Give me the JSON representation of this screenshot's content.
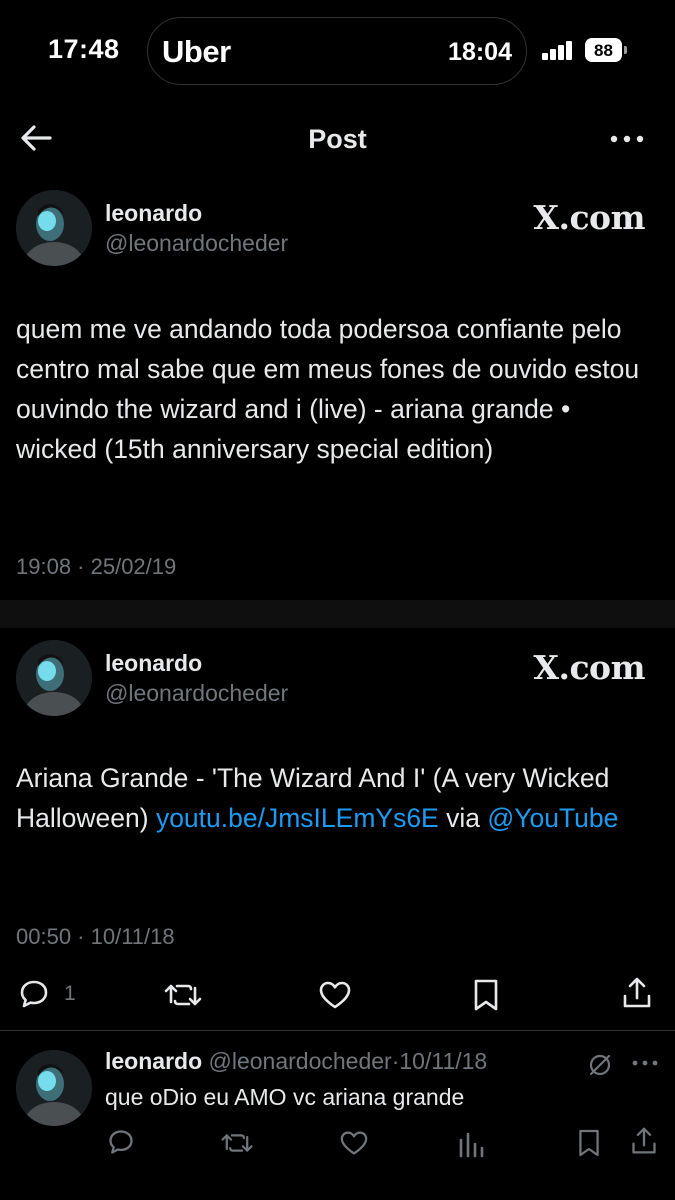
{
  "status_bar": {
    "time": "17:48",
    "live_activity_app": "Uber",
    "live_activity_time": "18:04",
    "battery": "88"
  },
  "header": {
    "title": "Post",
    "back_icon": "arrow-left-icon",
    "more_icon": "more-horizontal-icon"
  },
  "posts": [
    {
      "display_name": "leonardo",
      "handle": "@leonardocheder",
      "source": "X.com",
      "text": "quem me ve andando toda podersoa confiante pelo centro mal sabe que em meus fones de ouvido estou ouvindo the wizard and i (live) - ariana grande • wicked (15th anniversary special edition)",
      "timestamp": "19:08 · 25/02/19"
    },
    {
      "display_name": "leonardo",
      "handle": "@leonardocheder",
      "source": "X.com",
      "text_before_link": "Ariana Grande - 'The Wizard And I' (A very Wicked Halloween) ",
      "link": "youtu.be/JmsILEmYs6E",
      "text_after_link": " via ",
      "mention": "@YouTube",
      "timestamp": "00:50 · 10/11/18",
      "actions": {
        "reply_count": "1"
      }
    }
  ],
  "reply": {
    "display_name": "leonardo",
    "handle": "@leonardocheder",
    "date": "10/11/18",
    "text": "que oDio eu AMO vc ariana grande"
  },
  "colors": {
    "background": "#000000",
    "text": "#e7e9ea",
    "secondary": "#71767b",
    "link": "#1d9bf0",
    "divider": "#2f3336"
  }
}
